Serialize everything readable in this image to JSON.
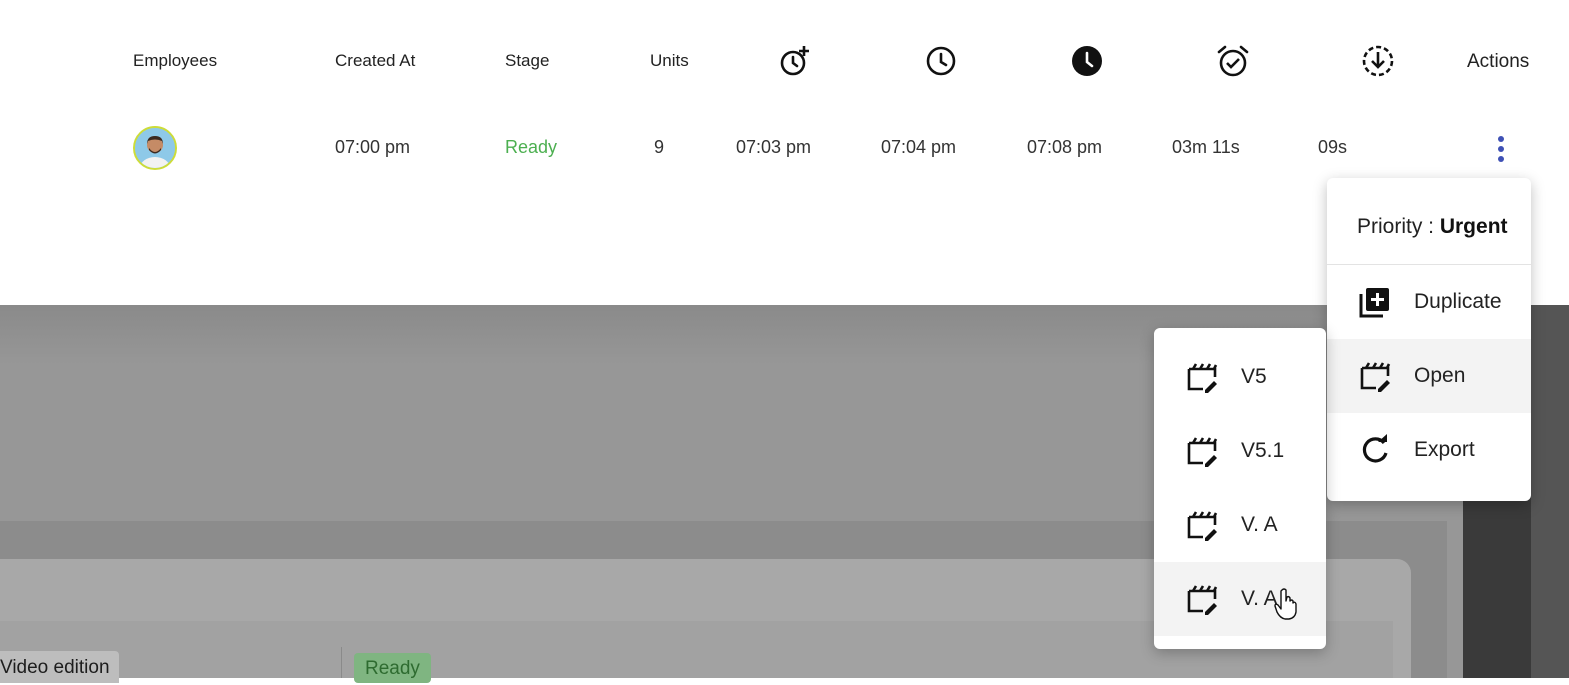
{
  "table": {
    "headers": {
      "employees": "Employees",
      "created_at": "Created At",
      "stage": "Stage",
      "units": "Units",
      "actions": "Actions"
    },
    "header_icons": [
      "alarm-add-icon",
      "clock-outline-icon",
      "clock-filled-icon",
      "alarm-check-icon",
      "download-circle-icon"
    ],
    "row": {
      "created_at": "07:00 pm",
      "stage": "Ready",
      "units": "9",
      "time1": "07:03 pm",
      "time2": "07:04 pm",
      "time3": "07:08 pm",
      "duration1": "03m 11s",
      "duration2": "09s"
    }
  },
  "actions_menu": {
    "priority_label": "Priority : ",
    "priority_value": "Urgent",
    "items": [
      {
        "label": "Duplicate",
        "icon": "library-add-icon"
      },
      {
        "label": "Open",
        "icon": "movie-edit-icon"
      },
      {
        "label": "Export",
        "icon": "refresh-icon"
      }
    ]
  },
  "open_submenu": {
    "items": [
      {
        "label": "V5",
        "icon": "movie-edit-icon"
      },
      {
        "label": "V5.1",
        "icon": "movie-edit-icon"
      },
      {
        "label": "V. A",
        "icon": "movie-edit-icon"
      },
      {
        "label": "V. A",
        "icon": "movie-edit-icon"
      }
    ]
  },
  "background": {
    "chip_label": "Video edition",
    "status_label": "Ready"
  },
  "colors": {
    "ready_green": "#4caf50",
    "kebab_blue": "#3f51b5"
  }
}
